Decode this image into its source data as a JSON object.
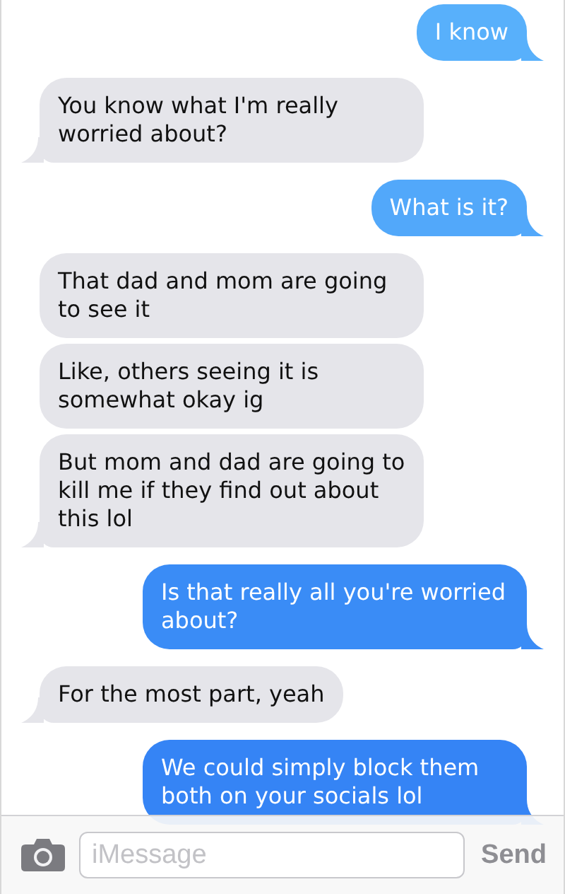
{
  "messages": [
    {
      "text": "I know",
      "outgoing": true,
      "tail": true,
      "color": "#58b0fb"
    },
    {
      "text": "You know what I'm really worried about?",
      "outgoing": false,
      "tail": true
    },
    {
      "text": "What is it?",
      "outgoing": true,
      "tail": true,
      "color": "#52a8fa"
    },
    {
      "text": "That dad and mom are going to see it",
      "outgoing": false,
      "tail": false
    },
    {
      "text": "Like, others seeing it is somewhat okay ig",
      "outgoing": false,
      "tail": false
    },
    {
      "text": "But mom and dad are going to kill me if they find out about this lol",
      "outgoing": false,
      "tail": true
    },
    {
      "text": "Is that really all you're worried about?",
      "outgoing": true,
      "tail": true,
      "color": "#3a8cf6"
    },
    {
      "text": "For the most part, yeah",
      "outgoing": false,
      "tail": true
    },
    {
      "text": "We could simply block them both on your socials lol",
      "outgoing": true,
      "tail": true,
      "color": "#3584f5"
    }
  ],
  "composer": {
    "placeholder": "iMessage",
    "send": "Send"
  }
}
